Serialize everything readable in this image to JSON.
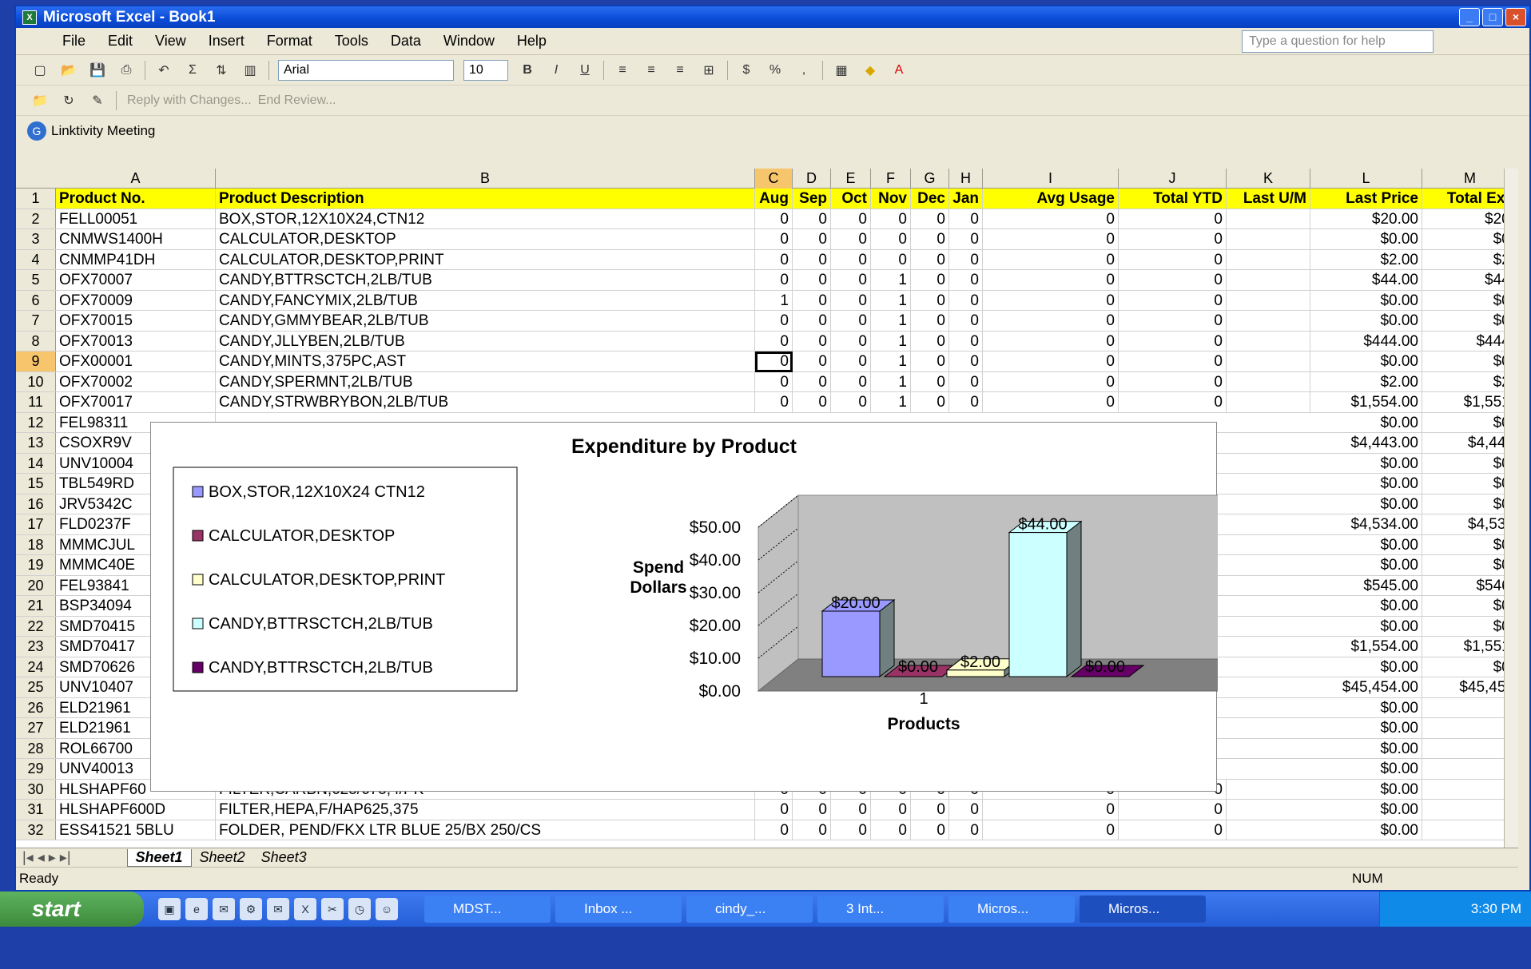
{
  "app_title": "Microsoft Excel - Book1",
  "window_buttons": [
    "_",
    "□",
    "×"
  ],
  "menu": [
    "File",
    "Edit",
    "View",
    "Insert",
    "Format",
    "Tools",
    "Data",
    "Window",
    "Help"
  ],
  "ask_placeholder": "Type a question for help",
  "formatting": {
    "font": "Arial",
    "size": "10",
    "bold": "B",
    "italic": "I",
    "underline": "U",
    "currency": "$",
    "percent": "%"
  },
  "review_toolbar": {
    "reply": "Reply with Changes...",
    "end": "End Review..."
  },
  "linktivity": "Linktivity Meeting",
  "columns": [
    "A",
    "B",
    "C",
    "D",
    "E",
    "F",
    "G",
    "H",
    "I",
    "J",
    "K",
    "L",
    "M"
  ],
  "header": [
    "Product No.",
    "Product Description",
    "Aug",
    "Sep",
    "Oct",
    "Nov",
    "Dec",
    "Jan",
    "Avg Usage",
    "Total YTD",
    "Last U/M",
    "Last Price",
    "Total Exp"
  ],
  "rows": [
    [
      "BOX,STOR,12X10X24,CTN12",
      "$20.00",
      "$20."
    ],
    [
      "CALCULATOR,DESKTOP",
      "$0.00",
      "$0."
    ],
    [
      "CALCULATOR,DESKTOP,PRINT",
      "$2.00",
      "$2."
    ],
    [
      "CANDY,BTTRSCTCH,2LB/TUB",
      "$44.00",
      "$44."
    ],
    [
      "CANDY,FANCYMIX,2LB/TUB",
      "$0.00",
      "$0."
    ],
    [
      "CANDY,GMMYBEAR,2LB/TUB",
      "$0.00",
      "$0."
    ],
    [
      "CANDY,JLLYBEN,2LB/TUB",
      "$444.00",
      "$444."
    ],
    [
      "CANDY,MINTS,375PC,AST",
      "$0.00",
      "$0."
    ],
    [
      "CANDY,SPERMNT,2LB/TUB",
      "$2.00",
      "$2."
    ],
    [
      "CANDY,STRWBRYBON,2LB/TUB",
      "$1,554.00",
      "$1,551."
    ]
  ],
  "product_nos": [
    "FELL00051",
    "CNMWS1400H",
    "CNMMP41DH",
    "OFX70007",
    "OFX70009",
    "OFX70015",
    "OFX70013",
    "OFX00001",
    "OFX70002",
    "OFX70017",
    "FEL98311",
    "CSOXR9V",
    "UNV10004",
    "TBL549RD",
    "JRV5342C",
    "FLD0237F",
    "MMMCJUL",
    "MMMC40E",
    "FEL93841",
    "BSP34094",
    "SMD70415",
    "SMD70417",
    "SMD70626",
    "UNV10407",
    "ELD21961",
    "ELD21961",
    "ROL66700",
    "UNV40013",
    "HLSHAPF60",
    "HLSHAPF600D",
    "ESS41521 5BLU"
  ],
  "bottom_rows": [
    [
      "FILTER,CARBN,625/675,4/PK",
      "$0.00"
    ],
    [
      "FILTER,HEPA,F/HAP625,375",
      "$0.00"
    ],
    [
      "FOLDER, PEND/FKX LTR BLUE 25/BX 250/CS",
      "$0.00"
    ]
  ],
  "right_col_lower": [
    [
      "$0.00",
      "$0."
    ],
    [
      "$4,443.00",
      "$4,443"
    ],
    [
      "$0.00",
      "$0."
    ],
    [
      "$0.00",
      "$0."
    ],
    [
      "$0.00",
      "$0."
    ],
    [
      "$4,534.00",
      "$4,534"
    ],
    [
      "$0.00",
      "$0."
    ],
    [
      "$0.00",
      "$0."
    ],
    [
      "$545.00",
      "$546."
    ],
    [
      "$0.00",
      "$0."
    ],
    [
      "$0.00",
      "$0."
    ],
    [
      "$1,554.00",
      "$1,551."
    ],
    [
      "$0.00",
      "$0."
    ],
    [
      "$45,454.00",
      "$45,454"
    ],
    [
      "$0.00",
      ""
    ],
    [
      "$0.00",
      ""
    ],
    [
      "$0.00",
      ""
    ],
    [
      "$0.00",
      ""
    ]
  ],
  "chart_data": {
    "type": "bar",
    "title": "Expenditure by Product",
    "xlabel": "Products",
    "ylabel": "Spend Dollars",
    "categories": [
      "1"
    ],
    "series": [
      {
        "name": "BOX,STOR,12X10X24 CTN12",
        "values": [
          20
        ],
        "color": "#9999ff"
      },
      {
        "name": "CALCULATOR,DESKTOP",
        "values": [
          0
        ],
        "color": "#993366"
      },
      {
        "name": "CALCULATOR,DESKTOP,PRINT",
        "values": [
          2
        ],
        "color": "#ffffcc"
      },
      {
        "name": "CANDY,BTTRSCTCH,2LB/TUB",
        "values": [
          44
        ],
        "color": "#ccffff"
      },
      {
        "name": "CANDY,BTTRSCTCH,2LB/TUB",
        "values": [
          0
        ],
        "color": "#660066"
      }
    ],
    "data_labels": [
      "$20.00",
      "$0.00",
      "$2.00",
      "$44.00",
      "$0.00"
    ],
    "yticks": [
      "$50.00",
      "$40.00",
      "$30.00",
      "$20.00",
      "$10.00",
      "$0.00"
    ],
    "ylim": [
      0,
      50
    ],
    "legend": "left"
  },
  "sheet_tabs": [
    "Sheet1",
    "Sheet2",
    "Sheet3"
  ],
  "status": "Ready",
  "status_num": "NUM",
  "taskbar": {
    "start": "start",
    "tasks": [
      "MDST...",
      "Inbox ...",
      "cindy_...",
      "3 Int...",
      "Micros...",
      "Micros..."
    ],
    "clock": "3:30 PM"
  }
}
